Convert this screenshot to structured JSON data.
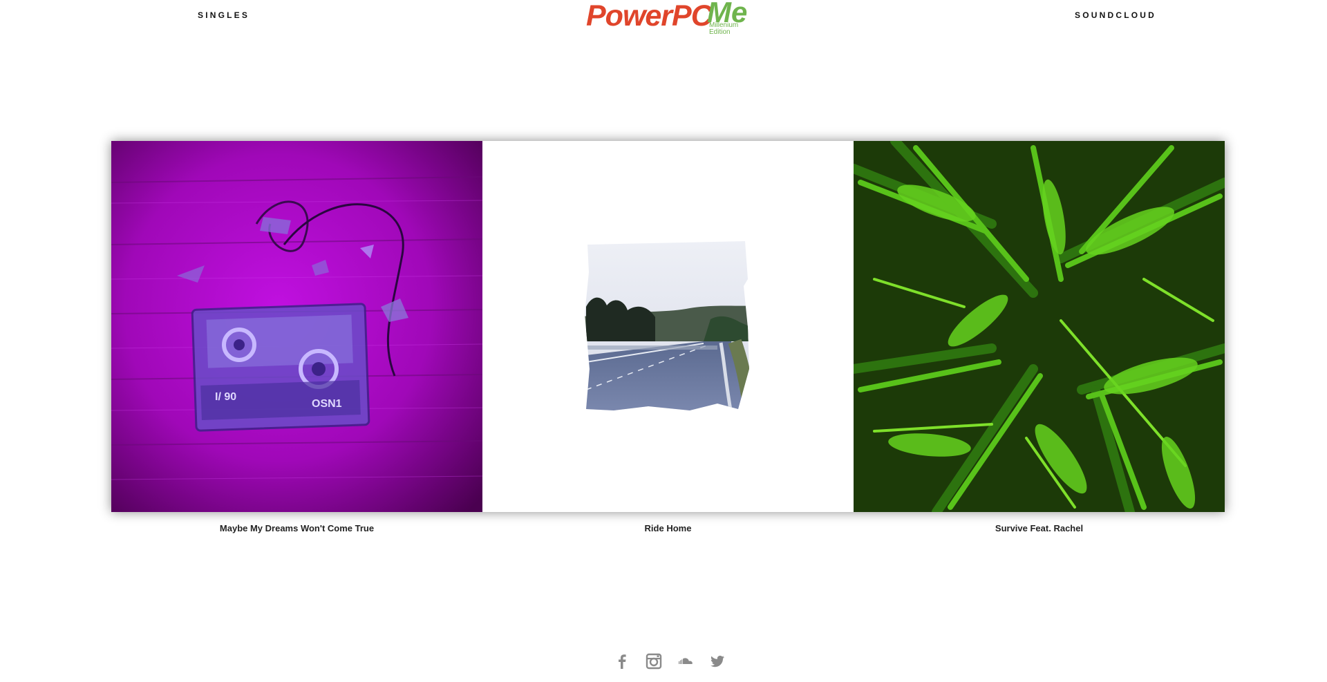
{
  "header": {
    "nav_left": "SINGLES",
    "nav_right": "SOUNDCLOUD",
    "logo": {
      "main": "PowerPC",
      "accent": "Me",
      "sub_line1": "Millenium",
      "sub_line2": "Edition"
    }
  },
  "singles": [
    {
      "title": "Maybe My Dreams Won't Come True",
      "art": "purple-cassette-art"
    },
    {
      "title": "Ride Home",
      "art": "road-photo-art"
    },
    {
      "title": "Survive Feat. Rachel",
      "art": "fern-art"
    }
  ],
  "social": [
    {
      "icon": "facebook-icon"
    },
    {
      "icon": "instagram-icon"
    },
    {
      "icon": "soundcloud-icon"
    },
    {
      "icon": "twitter-icon"
    }
  ],
  "colors": {
    "logo_red": "#e0452b",
    "logo_green": "#6fb44d",
    "icon_gray": "#8a8a8a"
  }
}
